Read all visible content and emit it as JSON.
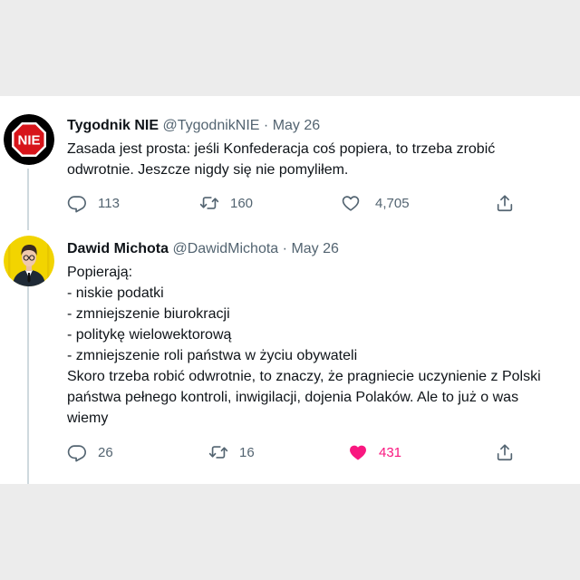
{
  "tweets": [
    {
      "name": "Tygodnik NIE",
      "handle": "@TygodnikNIE",
      "separator": "·",
      "date": "May 26",
      "avatar_text": "NIE",
      "text": "Zasada jest prosta: jeśli Konfederacja coś popiera, to trzeba zrobić\nodwrotnie. Jeszcze nigdy się nie pomyliłem.",
      "replies": "113",
      "retweets": "160",
      "likes": "4,705",
      "liked": false
    },
    {
      "name": "Dawid Michota",
      "handle": "@DawidMichota",
      "separator": "·",
      "date": "May 26",
      "text": "Popierają:\n- niskie podatki\n- zmniejszenie biurokracji\n- politykę wielowektorową\n- zmniejszenie roli państwa w życiu obywateli\nSkoro trzeba robić odwrotnie, to znaczy, że pragniecie uczynienie z Polski\npaństwa pełnego kontroli, inwigilacji, dojenia Polaków. Ale to już o was\nwiemy",
      "replies": "26",
      "retweets": "16",
      "likes": "431",
      "liked": true
    }
  ],
  "icons": {
    "reply": "reply-icon",
    "retweet": "retweet-icon",
    "like": "heart-icon",
    "share": "share-icon"
  },
  "colors": {
    "liked": "#f91880",
    "muted": "#536471",
    "stop_sign": "#d7141a",
    "avatar_bg": "#f2d400"
  }
}
